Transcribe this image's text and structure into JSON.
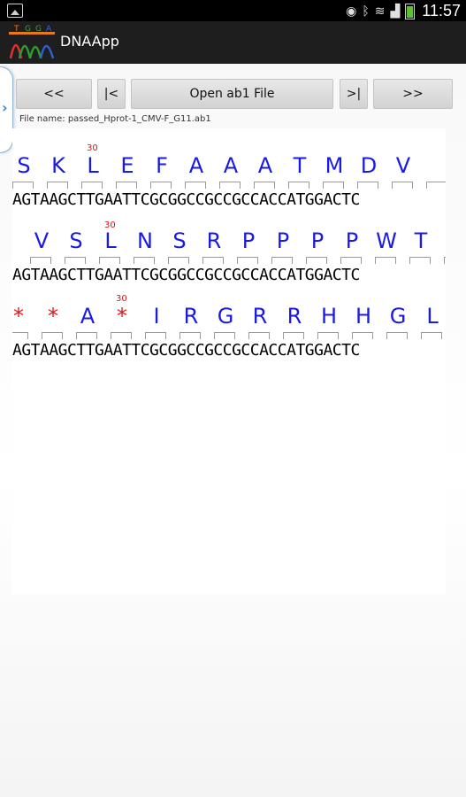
{
  "status_bar": {
    "time": "11:57",
    "icons": [
      "image-icon",
      "eye-icon",
      "bluetooth-icon",
      "wifi-icon",
      "signal-icon",
      "battery-icon"
    ]
  },
  "app": {
    "title": "DNAApp",
    "logo_letters": "TGGA"
  },
  "toolbar": {
    "first": "<<",
    "prev": "|<",
    "open": "Open ab1 File",
    "next": ">|",
    "last": ">>"
  },
  "file": {
    "label": "File name: passed_Hprot-1_CMV-F_G11.ab1"
  },
  "sequence": {
    "dna": "AGTAAGCTTGAATTCGCGGCCGCCGCCACCATGGACTC",
    "frames": [
      {
        "aa": [
          "S",
          "K",
          "L",
          "E",
          "F",
          "A",
          "A",
          "A",
          "T",
          "M",
          "D",
          "V"
        ],
        "pos_label": "30",
        "color": "#1a1ae6"
      },
      {
        "aa": [
          "V",
          "S",
          "L",
          "N",
          "S",
          "R",
          "P",
          "P",
          "P",
          "P",
          "W",
          "T"
        ],
        "pos_label": "30",
        "color": "#1a1ae6"
      },
      {
        "aa": [
          "*",
          "*",
          "A",
          "*",
          "I",
          "R",
          "G",
          "R",
          "R",
          "H",
          "H",
          "G",
          "L"
        ],
        "pos_label": "30",
        "color": "#1a1ae6",
        "stop_color": "#ee1111"
      }
    ]
  }
}
